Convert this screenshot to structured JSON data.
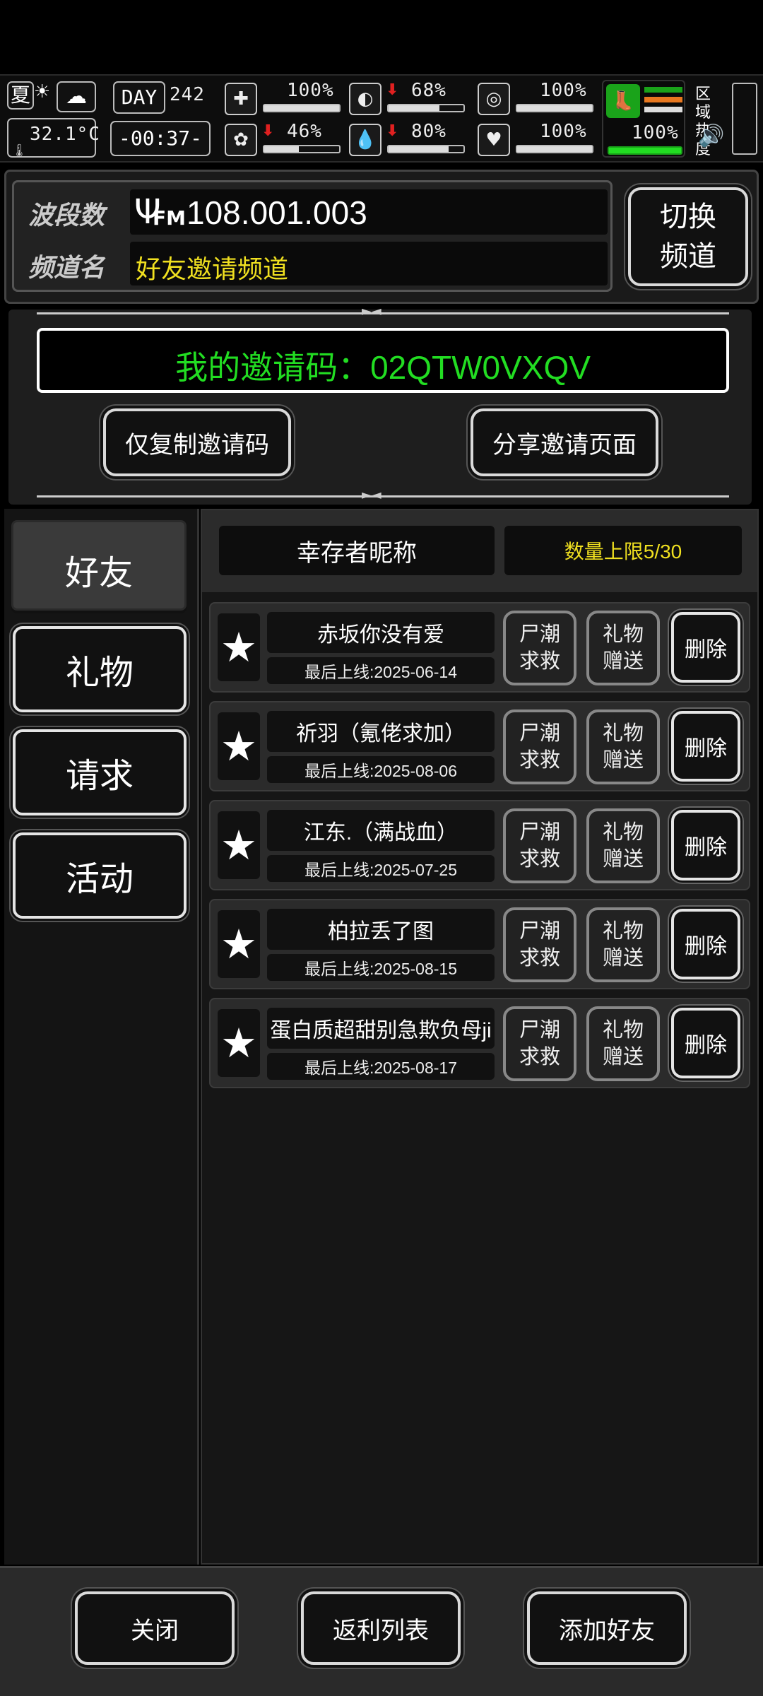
{
  "hud": {
    "season": "夏",
    "temperature": "32.1°C",
    "day_label": "DAY",
    "day_number": "242",
    "clock": "-00:37-",
    "stats": [
      {
        "icon": "medkit-icon",
        "value": "100%",
        "level": 1.0,
        "down": false
      },
      {
        "icon": "stomach-icon",
        "value": "68%",
        "level": 0.68,
        "down": true
      },
      {
        "icon": "pill-icon",
        "value": "100%",
        "level": 1.0,
        "down": false
      },
      {
        "icon": "brain-icon",
        "value": "46%",
        "level": 0.46,
        "down": true
      },
      {
        "icon": "water-drop-icon",
        "value": "80%",
        "level": 0.8,
        "down": true
      },
      {
        "icon": "heart-icon",
        "value": "100%",
        "level": 1.0,
        "down": false
      }
    ],
    "stamina_value": "100%",
    "stamina_level": 1.0,
    "area_heat_label": "区域热度"
  },
  "radio": {
    "band_label": "波段数",
    "band_value": "108.001.003",
    "fm_label": "FM",
    "channel_label": "频道名",
    "channel_value": "好友邀请频道",
    "switch_button": "切换频道"
  },
  "invite": {
    "code_text": "我的邀请码：02QTW0VXQV",
    "copy_button": "仅复制邀请码",
    "share_button": "分享邀请页面"
  },
  "tabs": [
    "好友",
    "礼物",
    "请求",
    "活动"
  ],
  "list_header": {
    "nickname_label": "幸存者昵称",
    "limit_text": "数量上限5/30"
  },
  "friends": [
    {
      "name": "赤坂你没有爱",
      "last": "最后上线:2025-06-14"
    },
    {
      "name": "祈羽（氪佬求加）",
      "last": "最后上线:2025-08-06"
    },
    {
      "name": "江东.（满战血）",
      "last": "最后上线:2025-07-25"
    },
    {
      "name": "柏拉丢了图",
      "last": "最后上线:2025-08-15"
    },
    {
      "name": "蛋白质超甜别急欺负母ji",
      "last": "最后上线:2025-08-17"
    }
  ],
  "row_buttons": {
    "rescue": "尸潮求救",
    "gift": "礼物赠送",
    "delete": "删除"
  },
  "footer": {
    "close": "关闭",
    "rebate": "返利列表",
    "add_friend": "添加好友"
  },
  "colors": {
    "accent_green": "#22dd22",
    "accent_yellow": "#f0e020",
    "alert_red": "#e02020"
  }
}
